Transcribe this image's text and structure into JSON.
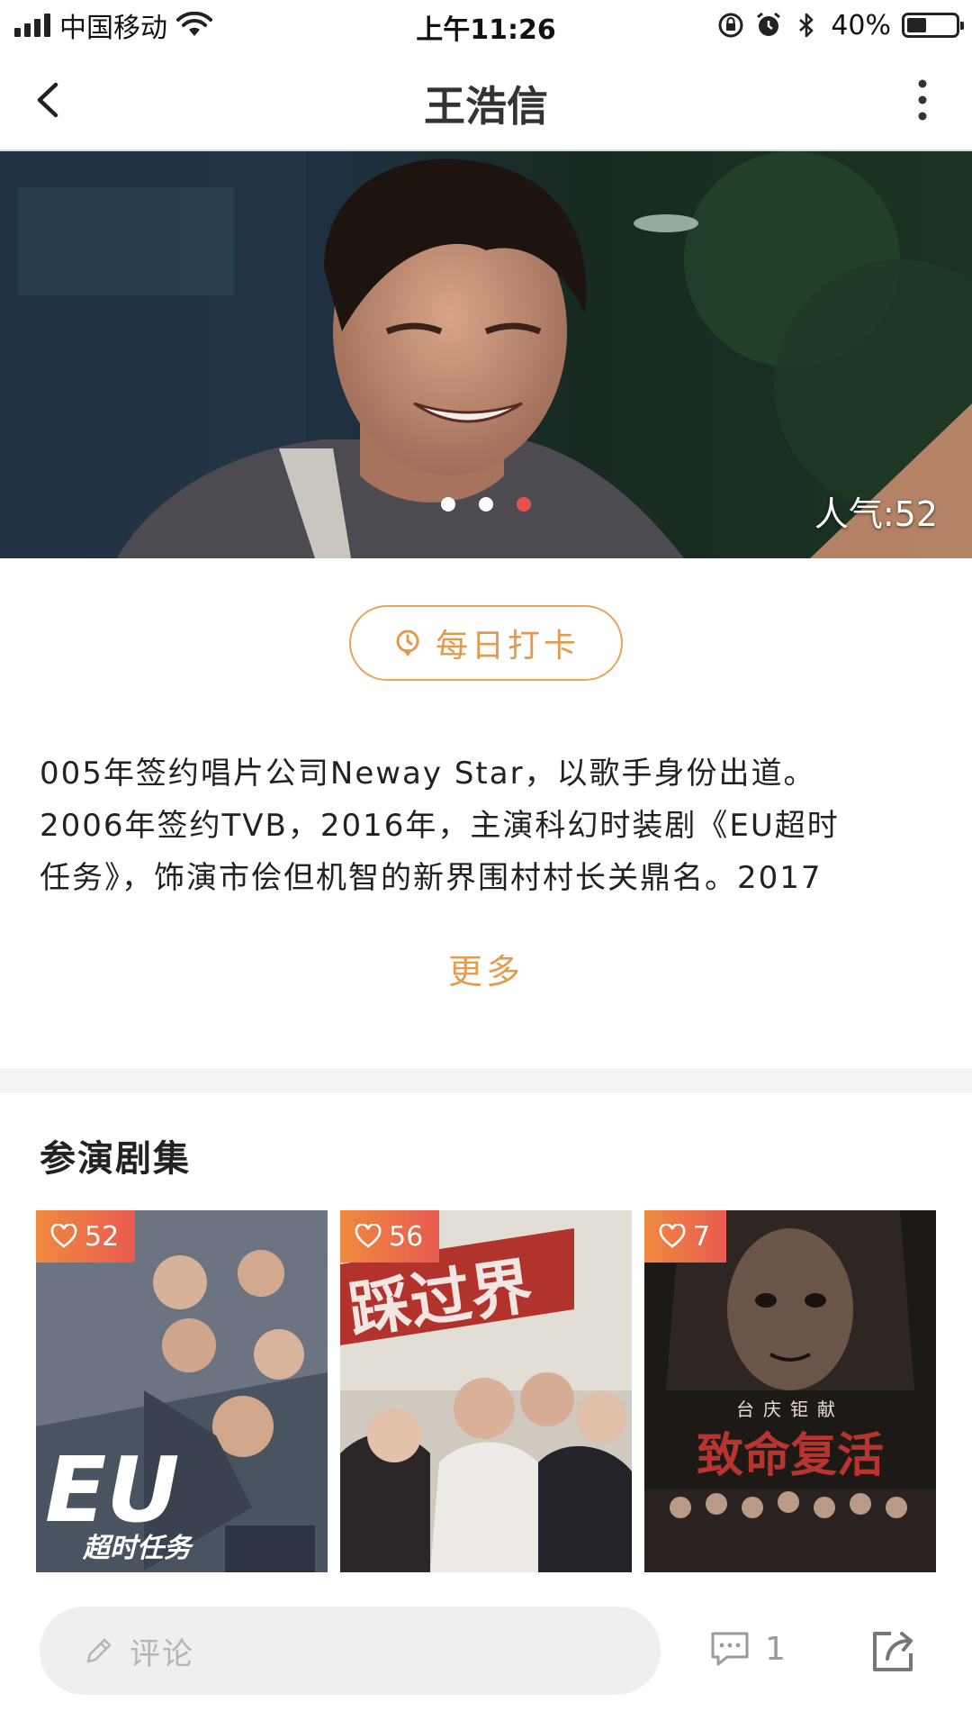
{
  "status_bar": {
    "carrier": "中国移动",
    "time": "上午11:26",
    "battery_percent": "40%",
    "battery_level": 0.4
  },
  "nav": {
    "title": "王浩信"
  },
  "hero": {
    "popularity": "人气:52",
    "dots": 3,
    "active_dot": 2
  },
  "checkin": {
    "label": "每日打卡"
  },
  "bio": {
    "lines": [
      "005年签约唱片公司Neway Star，以歌手身份出道。",
      "2006年签约TVB，2016年，主演科幻时装剧《EU超时",
      "任务》，饰演市侩但机智的新界围村村长关鼎名。2017"
    ],
    "more_label": "更多"
  },
  "section": {
    "title": "参演剧集"
  },
  "shows": [
    {
      "likes": "52",
      "poster_text": "EU",
      "poster_subtext": "超时任务"
    },
    {
      "likes": "56",
      "poster_text": "踩过界",
      "poster_subtext": ""
    },
    {
      "likes": "7",
      "poster_text": "致命复活",
      "poster_subtext": "台庆钜献"
    }
  ],
  "bottom_bar": {
    "comment_placeholder": "评论",
    "comment_count": "1"
  },
  "colors": {
    "accent_orange": "#e59c4f",
    "badge_start": "#ef8a3f",
    "badge_end": "#e85a4f",
    "active_dot": "#e8504f"
  }
}
